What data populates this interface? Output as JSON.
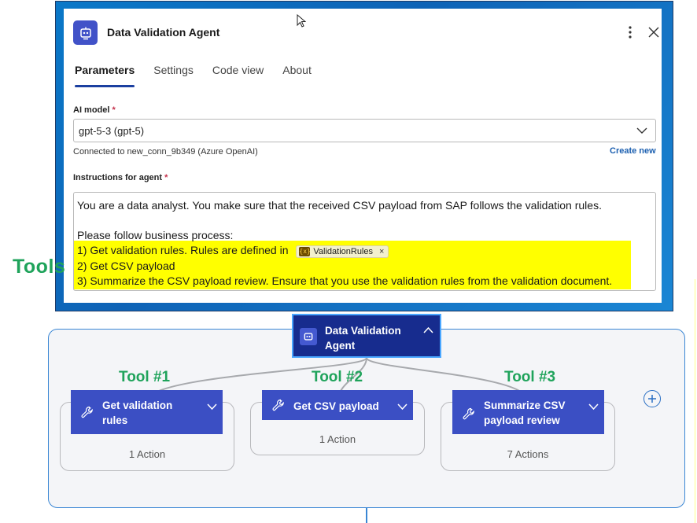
{
  "panel": {
    "title": "Data Validation Agent",
    "tabs": [
      "Parameters",
      "Settings",
      "Code view",
      "About"
    ],
    "active_tab": "Parameters",
    "ai_model": {
      "label": "AI model",
      "required_mark": "*",
      "value": "gpt-5-3 (gpt-5)",
      "connection_text": "Connected to new_conn_9b349 (Azure OpenAI)",
      "create_new": "Create new"
    },
    "instructions": {
      "label": "Instructions for agent",
      "required_mark": "*",
      "line1": "You are a data analyst. You make sure that the received CSV payload from SAP follows the validation rules.",
      "line2": "Please follow business process:",
      "line3": "1) Get validation rules. Rules are defined in",
      "chip_label": "ValidationRules",
      "chip_icon_text": "{x}",
      "chip_remove": "×",
      "line4": "2) Get CSV payload",
      "line5": "3) Summarize the CSV payload review. Ensure that you use the validation rules from the validation document."
    }
  },
  "annotations": {
    "tools": "Tools",
    "tool1": "Tool #1",
    "tool2": "Tool #2",
    "tool3": "Tool #3"
  },
  "flow": {
    "agent": {
      "label": "Data Validation Agent"
    },
    "tools": [
      {
        "label": "Get validation rules",
        "actions": "1 Action"
      },
      {
        "label": "Get CSV payload",
        "actions": "1 Action"
      },
      {
        "label": "Summarize CSV payload review",
        "actions": "7 Actions"
      }
    ]
  },
  "colors": {
    "accent": "#3b4fc4",
    "agent_node": "#172c8e",
    "highlight": "#ffff00",
    "annotation": "#1fa35b",
    "link": "#1b5fb0"
  }
}
